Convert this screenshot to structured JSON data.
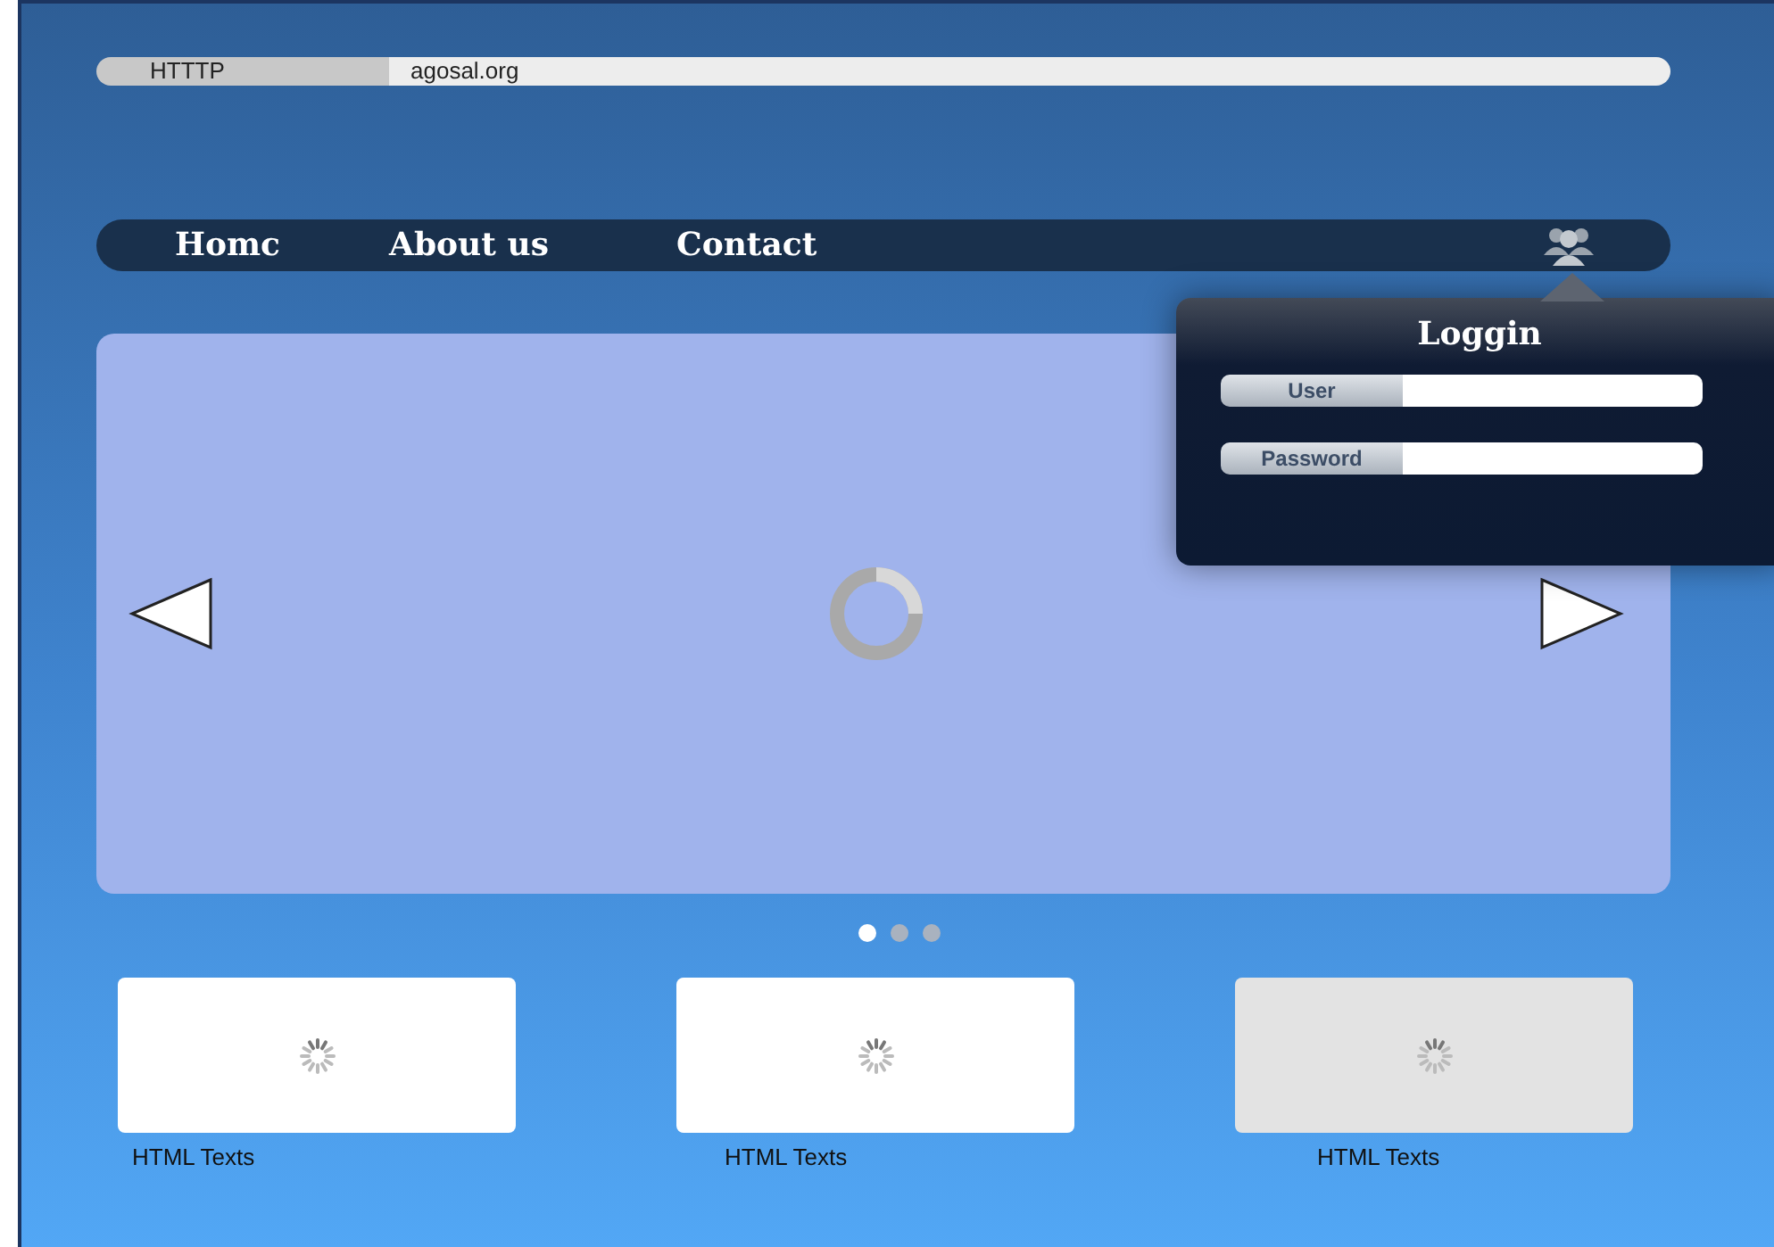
{
  "address_bar": {
    "protocol": "HTTTP",
    "url": "agosal.org"
  },
  "nav": {
    "items": [
      {
        "label": "Homc"
      },
      {
        "label": "About us"
      },
      {
        "label": "Contact"
      }
    ]
  },
  "login_popup": {
    "title": "Loggin",
    "fields": [
      {
        "label": "User"
      },
      {
        "label": "Password"
      }
    ]
  },
  "slider": {
    "dots": [
      {
        "selected": true
      },
      {
        "selected": false
      },
      {
        "selected": false
      }
    ]
  },
  "cards": [
    {
      "caption": "HTML Texts",
      "highlighted": false
    },
    {
      "caption": "HTML Texts",
      "highlighted": false
    },
    {
      "caption": "HTML Texts",
      "highlighted": true
    }
  ]
}
